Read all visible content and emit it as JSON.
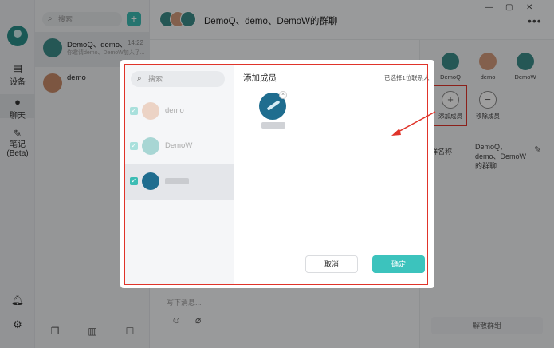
{
  "rail": {
    "items": [
      {
        "label": "设备",
        "icon": "device-icon"
      },
      {
        "label": "聊天",
        "icon": "chat-icon"
      },
      {
        "label": "笔记",
        "sub": "(Beta)",
        "icon": "note-icon"
      }
    ]
  },
  "conv_search": {
    "placeholder": "搜索"
  },
  "conversations": [
    {
      "name": "DemoQ、demo、...",
      "time": "14:22",
      "preview": "你邀请demo、DemoW加入了..."
    },
    {
      "name": "demo"
    }
  ],
  "chat": {
    "title": "DemoQ、demo、DemoW的群聊",
    "window_controls": [
      "—",
      "▢",
      "✕"
    ],
    "input_placeholder": "写下消息..."
  },
  "members_panel": {
    "members": [
      {
        "name": "DemoQ"
      },
      {
        "name": "demo"
      },
      {
        "name": "DemoW"
      }
    ],
    "add_label": "添加成员",
    "remove_label": "移除成员",
    "group_name_label": "群名称",
    "group_name_value": "DemoQ、demo、DemoW的群聊",
    "dissolve_label": "解散群组"
  },
  "modal": {
    "search_placeholder": "搜索",
    "contacts": [
      {
        "name": "demo",
        "checked": true,
        "disabled": true
      },
      {
        "name": "DemoW",
        "checked": true,
        "disabled": true
      },
      {
        "name": "",
        "checked": true,
        "disabled": false
      }
    ],
    "title": "添加成员",
    "selected_count": "已选择1位联系人",
    "cancel_label": "取消",
    "confirm_label": "确定"
  },
  "colors": {
    "accent": "#3cc3bd",
    "highlight": "#e0342a"
  }
}
